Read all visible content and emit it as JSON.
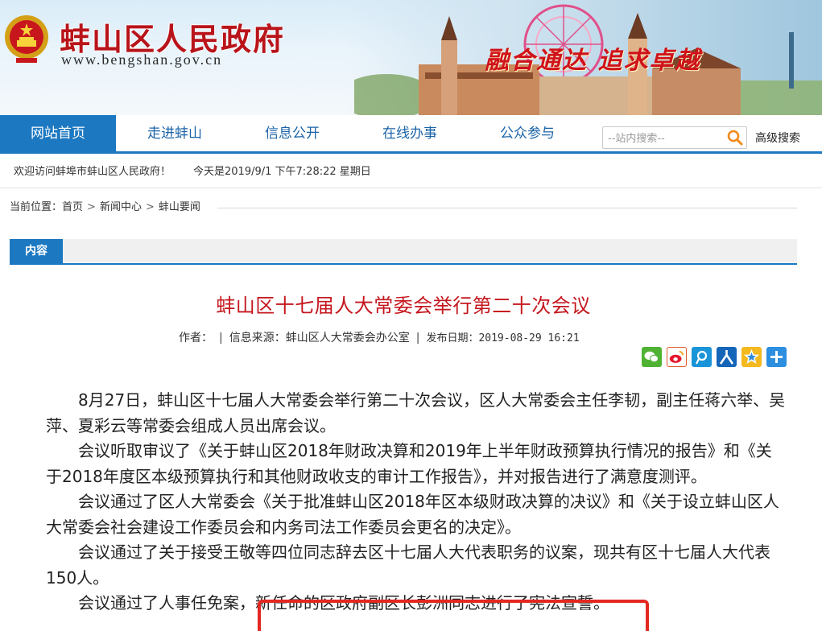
{
  "header": {
    "site_title": "蚌山区人民政府",
    "site_url": "www.bengshan.gov.cn",
    "slogan": "融合通达 追求卓越",
    "emblem_icon": "national-emblem-icon"
  },
  "nav": {
    "items": [
      {
        "label": "网站首页",
        "active": true
      },
      {
        "label": "走进蚌山"
      },
      {
        "label": "信息公开"
      },
      {
        "label": "在线办事"
      },
      {
        "label": "公众参与"
      }
    ],
    "search_placeholder": "--站内搜索--",
    "search_icon": "search-icon",
    "advanced_search": "高级搜索"
  },
  "welcome": {
    "greeting": "欢迎访问蚌埠市蚌山区人民政府！",
    "today": "今天是2019/9/1 下午7:28:22 星期日"
  },
  "breadcrumb": {
    "prefix": "当前位置：",
    "items": [
      "首页",
      "新闻中心",
      "蚌山要闻"
    ],
    "separator": ">"
  },
  "content_tab": "内容",
  "article": {
    "title": "蚌山区十七届人大常委会举行第二十次会议",
    "author_label": "作者：",
    "source": "信息来源：蚌山区人大常委会办公室",
    "date": "发布日期：2019-08-29 16:21",
    "share_icons": [
      "wechat-icon",
      "weibo-icon",
      "tencent-weibo-icon",
      "renren-icon",
      "qzone-icon",
      "more-share-icon"
    ],
    "paragraphs": [
      "8月27日，蚌山区十七届人大常委会举行第二十次会议，区人大常委会主任李韧，副主任蒋六举、吴萍、夏彩云等常委会组成人员出席会议。",
      "会议听取审议了《关于蚌山区2018年财政决算和2019年上半年财政预算执行情况的报告》和《关于2018年度区本级预算执行和其他财政收支的审计工作报告》，并对报告进行了满意度测评。",
      "会议通过了区人大常委会《关于批准蚌山区2018年区本级财政决算的决议》和《关于设立蚌山区人大常委会社会建设工作委员会和内务司法工作委员会更名的决定》。",
      "会议通过了关于接受王敬等四位同志辞去区十七届人大代表职务的议案，现共有区十七届人大代表150人。",
      "会议通过了人事任免案，新任命的区政府副区长彭洲同志进行了宪法宣誓。"
    ]
  },
  "colors": {
    "brand_blue": "#1c78c1",
    "title_red": "#c5161d",
    "highlight_red": "#e32822"
  }
}
